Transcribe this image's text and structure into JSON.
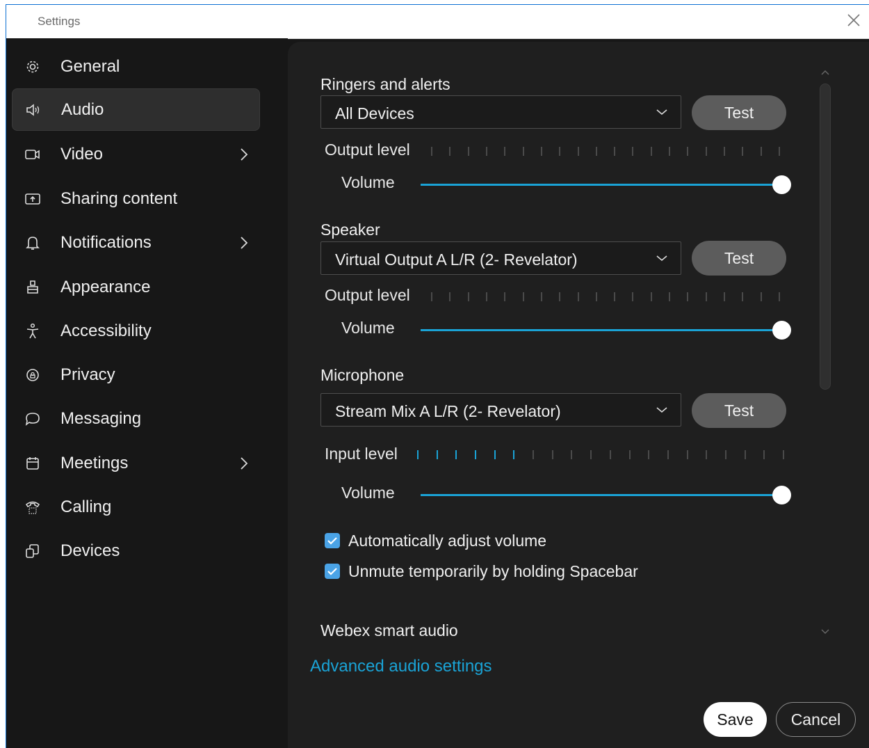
{
  "window": {
    "title": "Settings"
  },
  "sidebar": {
    "items": [
      {
        "label": "General",
        "icon": "gear-icon"
      },
      {
        "label": "Audio",
        "icon": "speaker-icon",
        "active": true
      },
      {
        "label": "Video",
        "icon": "video-camera-icon",
        "has_submenu": true
      },
      {
        "label": "Sharing content",
        "icon": "screen-share-icon"
      },
      {
        "label": "Notifications",
        "icon": "bell-icon",
        "has_submenu": true
      },
      {
        "label": "Appearance",
        "icon": "paint-brush-icon"
      },
      {
        "label": "Accessibility",
        "icon": "accessibility-person-icon"
      },
      {
        "label": "Privacy",
        "icon": "privacy-shield-icon"
      },
      {
        "label": "Messaging",
        "icon": "chat-bubble-icon"
      },
      {
        "label": "Meetings",
        "icon": "calendar-icon",
        "has_submenu": true
      },
      {
        "label": "Calling",
        "icon": "phone-icon"
      },
      {
        "label": "Devices",
        "icon": "devices-icon"
      }
    ]
  },
  "audio": {
    "ringers": {
      "title": "Ringers and alerts",
      "device": "All Devices",
      "test_label": "Test",
      "level_label": "Output level",
      "level_active_ticks": 0,
      "volume_label": "Volume",
      "volume": 1.0
    },
    "speaker": {
      "title": "Speaker",
      "device": "Virtual Output A L/R (2- Revelator)",
      "test_label": "Test",
      "level_label": "Output level",
      "level_active_ticks": 0,
      "volume_label": "Volume",
      "volume": 1.0
    },
    "microphone": {
      "title": "Microphone",
      "device": "Stream Mix A L/R (2- Revelator)",
      "test_label": "Test",
      "level_label": "Input level",
      "level_active_ticks": 6,
      "volume_label": "Volume",
      "volume": 1.0
    },
    "options": {
      "auto_adjust": {
        "label": "Automatically adjust volume",
        "checked": true
      },
      "unmute_spacebar": {
        "label": "Unmute temporarily by holding Spacebar",
        "checked": true
      }
    },
    "smart_audio": {
      "title": "Webex smart audio",
      "advanced_link": "Advanced audio settings"
    }
  },
  "footer": {
    "save_label": "Save",
    "cancel_label": "Cancel"
  },
  "colors": {
    "accent": "#1aa3d6",
    "background": "#1f1f1f",
    "sidebar": "#171717",
    "checkbox": "#4aa3e6"
  }
}
